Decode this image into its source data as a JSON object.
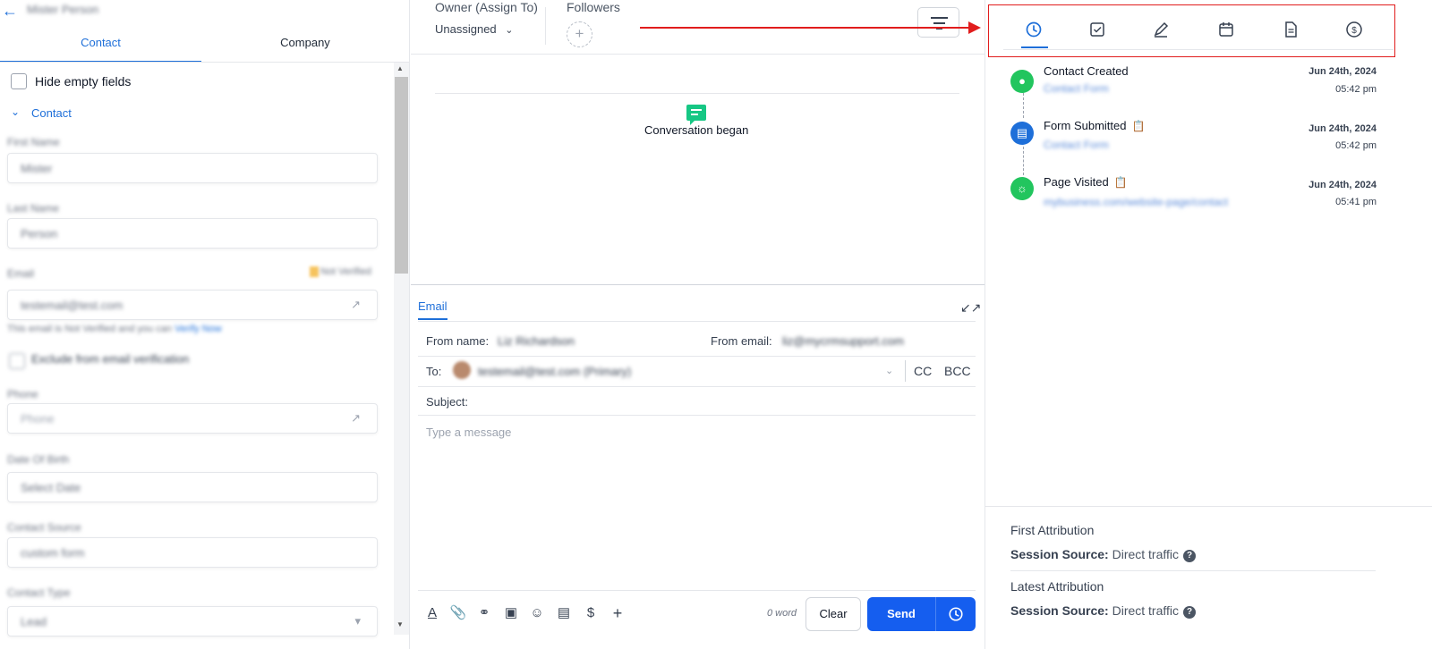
{
  "left_panel": {
    "back_icon": "arrow-left-icon",
    "contact_name": "Mister Person",
    "tabs": [
      {
        "label": "Contact"
      },
      {
        "label": "Company"
      }
    ],
    "hide_empty_label": "Hide empty fields",
    "section_label": "Contact",
    "fields": [
      {
        "label": "First Name",
        "value": "Mister"
      },
      {
        "label": "Last Name",
        "value": "Person"
      },
      {
        "label": "Email",
        "value": "testemail@test.com",
        "badge": "Not Verified",
        "hint": "This email is Not Verified and you can",
        "hint_link": "Verify Now"
      },
      {
        "label": "Phone",
        "value": "Phone"
      },
      {
        "label": "Date Of Birth",
        "value": "Select Date"
      },
      {
        "label": "Contact Source",
        "value": "custom form"
      },
      {
        "label": "Contact Type",
        "value": "Lead"
      }
    ],
    "exclude_label": "Exclude from email verification"
  },
  "middle_panel": {
    "owner_label": "Owner (Assign To)",
    "owner_value": "Unassigned",
    "followers_label": "Followers",
    "conversation_began": "Conversation began",
    "email_tab": "Email",
    "from_name_label": "From name:",
    "from_name_value": "Liz Richardson",
    "from_email_label": "From email:",
    "from_email_value": "liz@mycrmsupport.com",
    "to_label": "To:",
    "to_value": "testemail@test.com (Primary)",
    "cc_label": "CC",
    "bcc_label": "BCC",
    "subject_label": "Subject:",
    "message_placeholder": "Type a message",
    "word_count": "0 word",
    "clear_label": "Clear",
    "send_label": "Send"
  },
  "right_panel": {
    "tabs": [
      "activity-icon",
      "task-icon",
      "note-icon",
      "calendar-icon",
      "document-icon",
      "payment-icon"
    ],
    "events": [
      {
        "title": "Contact Created",
        "sub": "Contact Form",
        "date": "Jun 24th, 2024",
        "time": "05:42 pm",
        "color": "#22c55e"
      },
      {
        "title": "Form Submitted",
        "sub": "Contact Form",
        "date": "Jun 24th, 2024",
        "time": "05:42 pm",
        "color": "#1e6fd9"
      },
      {
        "title": "Page Visited",
        "sub": "mybusiness.com/website-page/contact",
        "date": "Jun 24th, 2024",
        "time": "05:41 pm",
        "color": "#22c55e"
      }
    ],
    "first_attribution_title": "First Attribution",
    "latest_attribution_title": "Latest Attribution",
    "session_source_label": "Session Source:",
    "first_session_source": "Direct traffic",
    "latest_session_source": "Direct traffic"
  },
  "colors": {
    "accent": "#1e6fd9",
    "send_button": "#155eef",
    "annotation_red": "#e11d1d",
    "event_green": "#22c55e"
  }
}
